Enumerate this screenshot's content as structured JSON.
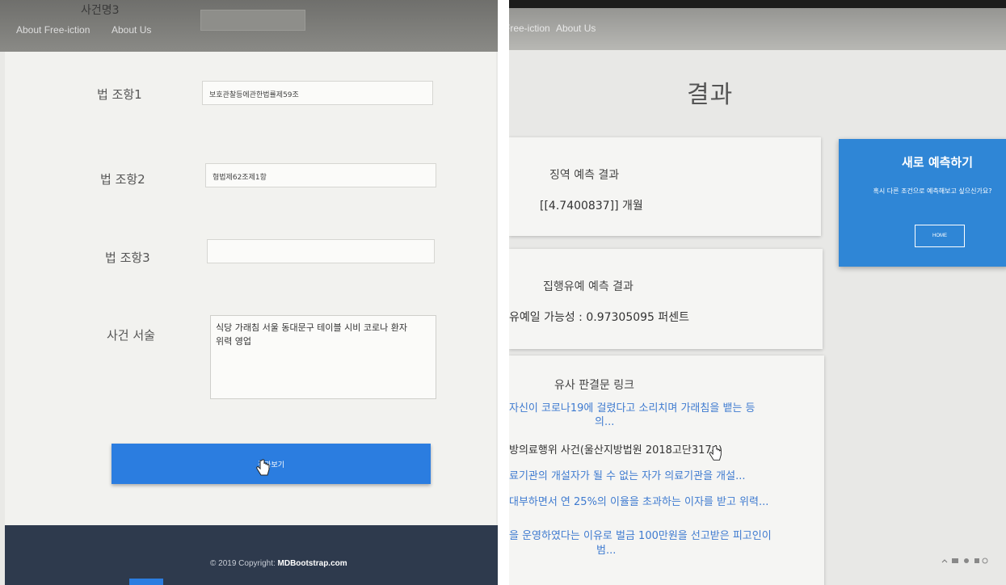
{
  "left": {
    "nav": {
      "clipped_label": "사건명3",
      "links": [
        "About Free-iction",
        "About Us"
      ]
    },
    "form": {
      "law1_label": "법 조항1",
      "law1_value": "보호관찰등에관한법률제59조",
      "law2_label": "법 조항2",
      "law2_value": "형법제62조제1항",
      "law3_label": "법 조항3",
      "law3_value": "",
      "desc_label": "사건 서술",
      "desc_line1": "식당 가래침 서울 동대문구 테이블 시비 코로나 환자",
      "desc_line2": "위력 영업",
      "submit_label": "결과보기"
    },
    "footer": {
      "prefix": "© 2019 Copyright: ",
      "brand": "MDBootstrap.com"
    }
  },
  "right": {
    "nav": {
      "links": [
        "Free-iction",
        "About Us"
      ]
    },
    "title": "결과",
    "prison_card": {
      "title": "징역 예측 결과",
      "value": "[[4.7400837]] 개월"
    },
    "probation_card": {
      "title": "집행유예 예측 결과",
      "value": "유예일 가능성 : 0.97305095 퍼센트"
    },
    "links_card": {
      "title": "유사 판결문 링크",
      "items": [
        {
          "line1": "자신이 코로나19에 걸렸다고 소리치며 가래침을 뱉는 등",
          "line2": "의..."
        },
        {
          "line1": "방의료행위 사건(울산지방법원 2018고단3174)",
          "line2": ""
        },
        {
          "line1": "료기관의 개설자가 될 수 없는 자가 의료기관을 개설...",
          "line2": ""
        },
        {
          "line1": "대부하면서 연 25%의 이율을 초과하는 이자를 받고 위력...",
          "line2": ""
        },
        {
          "line1": "을 운영하였다는 이유로 벌금 100만원을 선고받은 피고인이",
          "line2": "범..."
        }
      ]
    },
    "side_card": {
      "title": "새로 예측하기",
      "description": "혹시 다른 조건으로 예측해보고 싶으신가요?",
      "button_label": "HOME"
    }
  }
}
